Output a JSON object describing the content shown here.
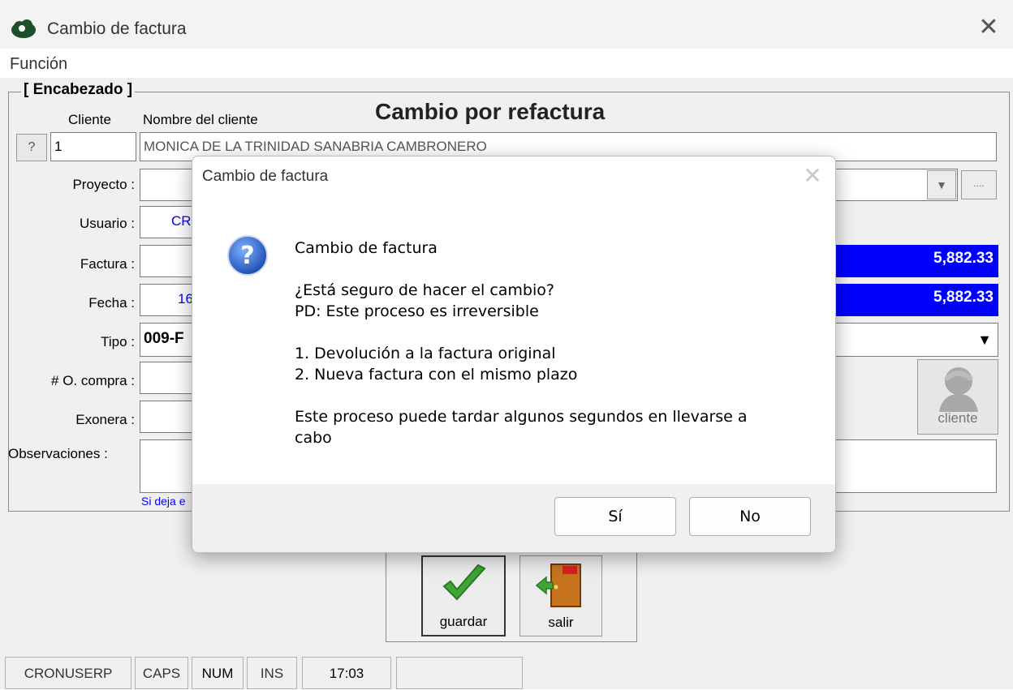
{
  "window": {
    "title": "Cambio de factura",
    "close_icon": "close-icon"
  },
  "menu": {
    "items": [
      "Función"
    ]
  },
  "form": {
    "group_label": "[ Encabezado ]",
    "heading": "Cambio por refactura",
    "cliente_label": "Cliente",
    "nombre_label": "Nombre del cliente",
    "lookup_label": "?",
    "cliente_code": "1",
    "cliente_name": "MONICA DE LA TRINIDAD SANABRIA CAMBRONERO",
    "proyecto_label": "Proyecto :",
    "ellipsis_label": "....",
    "usuario_label": "Usuario :",
    "usuario_value": "CR",
    "factura_label": "Factura :",
    "fecha_label": "Fecha :",
    "fecha_value": "16",
    "tipo_label": "Tipo :",
    "tipo_value": "009-F",
    "ocompra_label": "# O. compra :",
    "exonera_label": "Exonera :",
    "observaciones_label": "Observaciones :",
    "hint": "Si deja e",
    "amount1": "5,882.33",
    "amount2": "5,882.33",
    "cliente_button": "cliente"
  },
  "actions": {
    "guardar": "guardar",
    "salir": "salir"
  },
  "statusbar": {
    "user": "CRONUSERP",
    "caps": "CAPS",
    "num": "NUM",
    "ins": "INS",
    "time": "17:03",
    "extra": ""
  },
  "dialog": {
    "title": "Cambio de factura",
    "heading": "Cambio de factura",
    "question": "¿Está seguro de hacer el cambio?",
    "note": "PD: Este proceso es irreversible",
    "step1": "1. Devolución a la factura original",
    "step2": "2. Nueva factura con el mismo plazo",
    "warning_line1": "Este proceso puede tardar algunos segundos en llevarse a",
    "warning_line2": "cabo",
    "yes_label": "Sí",
    "no_label": "No"
  },
  "colors": {
    "amount_bg": "#0000ff",
    "hint_text": "#0000ff"
  }
}
